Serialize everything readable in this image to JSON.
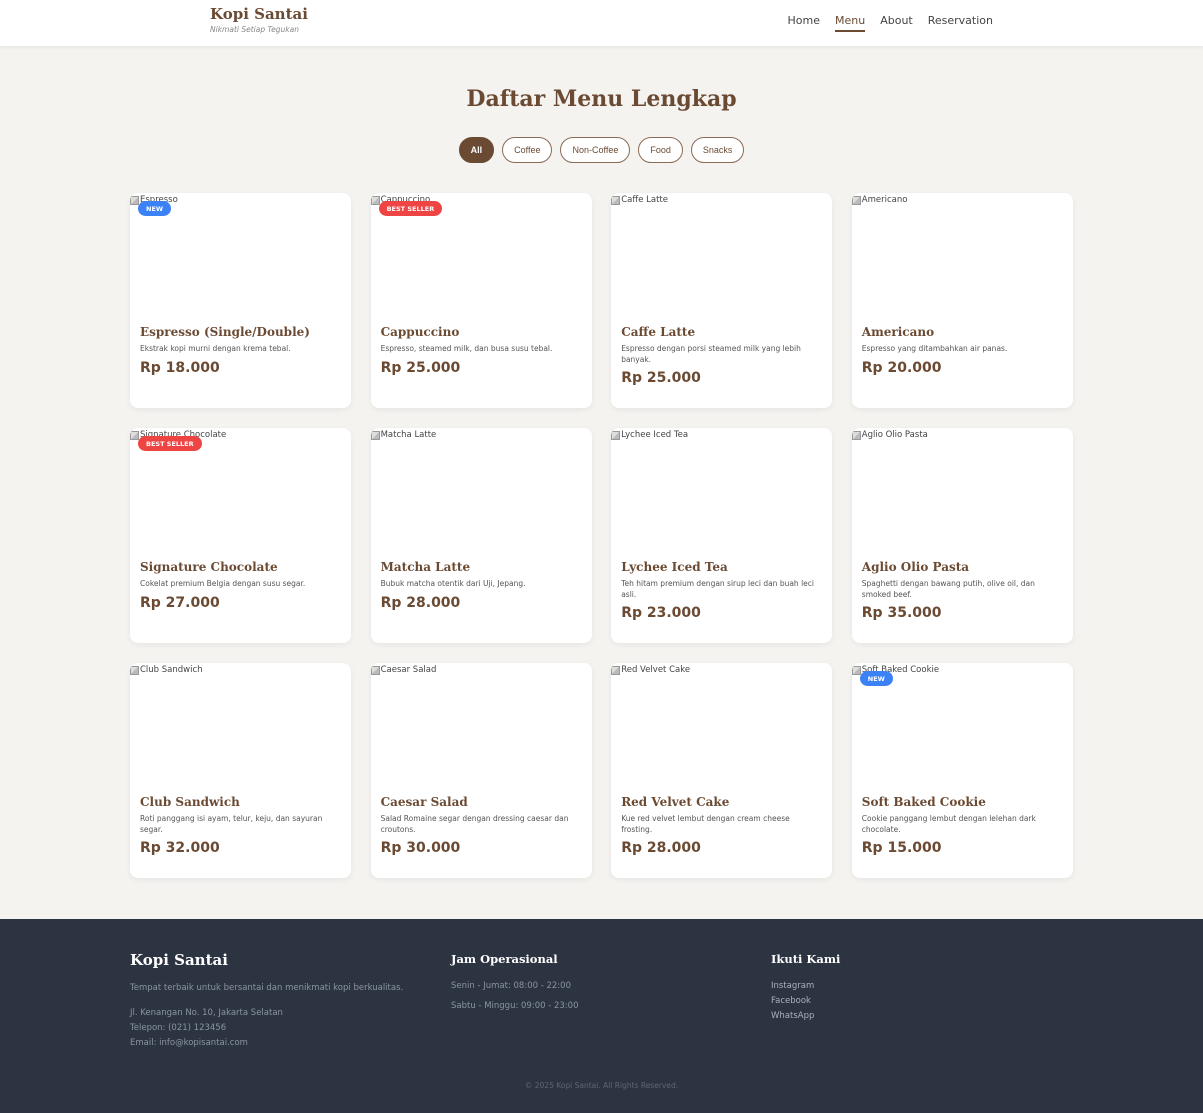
{
  "header": {
    "brand_name": "Kopi Santai",
    "brand_tagline": "Nikmati Setiap Tegukan",
    "nav": [
      {
        "label": "Home",
        "active": false
      },
      {
        "label": "Menu",
        "active": true
      },
      {
        "label": "About",
        "active": false
      },
      {
        "label": "Reservation",
        "active": false
      }
    ]
  },
  "page_title": "Daftar Menu Lengkap",
  "filters": [
    {
      "label": "All",
      "active": true
    },
    {
      "label": "Coffee",
      "active": false
    },
    {
      "label": "Non-Coffee",
      "active": false
    },
    {
      "label": "Food",
      "active": false
    },
    {
      "label": "Snacks",
      "active": false
    }
  ],
  "menu_items": [
    {
      "image_alt": "Espresso",
      "badge": "NEW",
      "name": "Espresso (Single/Double)",
      "desc": "Ekstrak kopi murni dengan krema tebal.",
      "price": "Rp 18.000"
    },
    {
      "image_alt": "Cappuccino",
      "badge": "BEST SELLER",
      "name": "Cappuccino",
      "desc": "Espresso, steamed milk, dan busa susu tebal.",
      "price": "Rp 25.000"
    },
    {
      "image_alt": "Caffe Latte",
      "badge": "",
      "name": "Caffe Latte",
      "desc": "Espresso dengan porsi steamed milk yang lebih banyak.",
      "price": "Rp 25.000"
    },
    {
      "image_alt": "Americano",
      "badge": "",
      "name": "Americano",
      "desc": "Espresso yang ditambahkan air panas.",
      "price": "Rp 20.000"
    },
    {
      "image_alt": "Signature Chocolate",
      "badge": "BEST SELLER",
      "name": "Signature Chocolate",
      "desc": "Cokelat premium Belgia dengan susu segar.",
      "price": "Rp 27.000"
    },
    {
      "image_alt": "Matcha Latte",
      "badge": "",
      "name": "Matcha Latte",
      "desc": "Bubuk matcha otentik dari Uji, Jepang.",
      "price": "Rp 28.000"
    },
    {
      "image_alt": "Lychee Iced Tea",
      "badge": "",
      "name": "Lychee Iced Tea",
      "desc": "Teh hitam premium dengan sirup leci dan buah leci asli.",
      "price": "Rp 23.000"
    },
    {
      "image_alt": "Aglio Olio Pasta",
      "badge": "",
      "name": "Aglio Olio Pasta",
      "desc": "Spaghetti dengan bawang putih, olive oil, dan smoked beef.",
      "price": "Rp 35.000"
    },
    {
      "image_alt": "Club Sandwich",
      "badge": "",
      "name": "Club Sandwich",
      "desc": "Roti panggang isi ayam, telur, keju, dan sayuran segar.",
      "price": "Rp 32.000"
    },
    {
      "image_alt": "Caesar Salad",
      "badge": "",
      "name": "Caesar Salad",
      "desc": "Salad Romaine segar dengan dressing caesar dan croutons.",
      "price": "Rp 30.000"
    },
    {
      "image_alt": "Red Velvet Cake",
      "badge": "",
      "name": "Red Velvet Cake",
      "desc": "Kue red velvet lembut dengan cream cheese frosting.",
      "price": "Rp 28.000"
    },
    {
      "image_alt": "Soft Baked Cookie",
      "badge": "NEW",
      "name": "Soft Baked Cookie",
      "desc": "Cookie panggang lembut dengan lelehan dark chocolate.",
      "price": "Rp 15.000"
    }
  ],
  "badge_colors": {
    "NEW": "#3b82f6",
    "BEST SELLER": "#ef4444"
  },
  "footer": {
    "brand": "Kopi Santai",
    "about": "Tempat terbaik untuk bersantai dan menikmati kopi berkualitas.",
    "address": "Jl. Kenangan No. 10, Jakarta Selatan",
    "phone": "Telepon: (021) 123456",
    "email": "Email: info@kopisantai.com",
    "hours_heading": "Jam Operasional",
    "hours": [
      "Senin - Jumat: 08:00 - 22:00",
      "Sabtu - Minggu: 09:00 - 23:00"
    ],
    "follow_heading": "Ikuti Kami",
    "social": [
      "Instagram",
      "Facebook",
      "WhatsApp"
    ],
    "copyright": "© 2025 Kopi Santai. All Rights Reserved."
  }
}
